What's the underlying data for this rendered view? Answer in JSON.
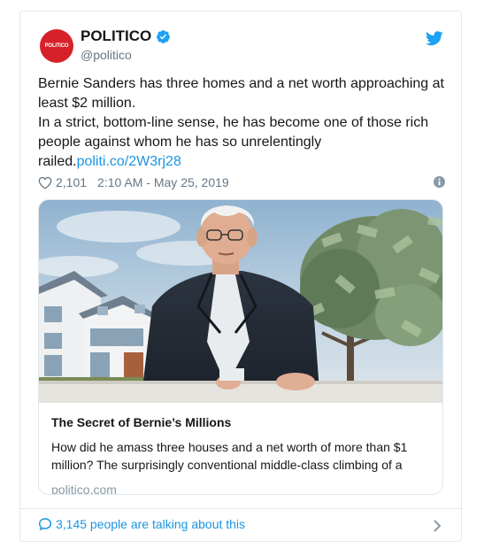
{
  "tweet": {
    "avatar_label": "POLITICO",
    "display_name": "POLITICO",
    "handle": "@politico",
    "text_line1": "Bernie Sanders has three homes and a net worth approaching at least $2 million.",
    "text_line2": "In a strict, bottom-line sense, he has become one of those rich people against whom he has so unrelentingly railed.",
    "link": "politi.co/2W3rj28",
    "likes": "2,101",
    "timestamp": "2:10 AM - May 25, 2019"
  },
  "card": {
    "title": "The Secret of Bernie’s Millions",
    "description": "How did he amass three houses and a net worth of more than $1 million? The surprisingly conventional middle-class climbing of a",
    "domain": "politico.com"
  },
  "footer": {
    "talking": "3,145 people are talking about this"
  },
  "colors": {
    "brand_red": "#d7212a",
    "twitter_blue": "#1b95e0",
    "muted": "#657786"
  },
  "icons": [
    "verified-badge-icon",
    "twitter-bird-icon",
    "heart-icon",
    "info-icon",
    "speech-bubble-icon",
    "chevron-right-icon"
  ]
}
